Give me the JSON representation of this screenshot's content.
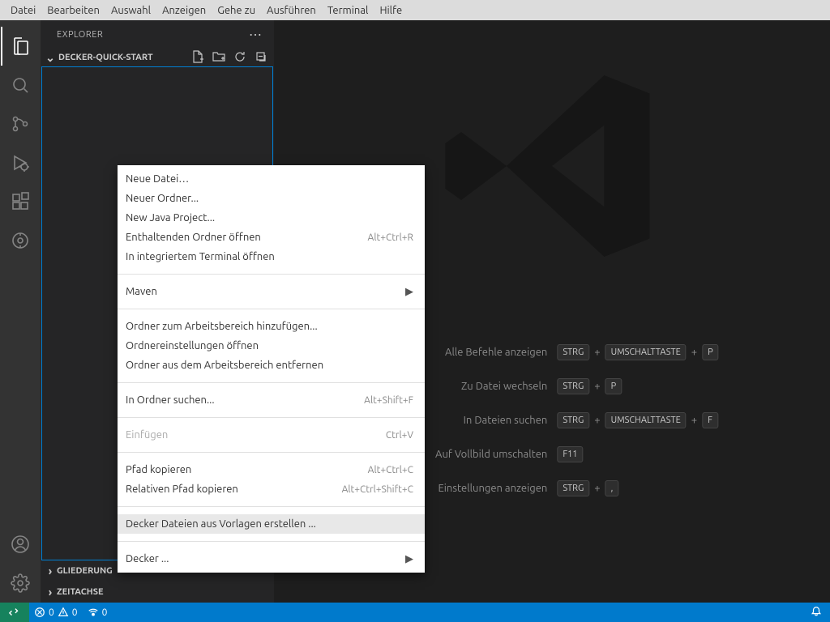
{
  "menubar": [
    "Datei",
    "Bearbeiten",
    "Auswahl",
    "Anzeigen",
    "Gehe zu",
    "Ausführen",
    "Terminal",
    "Hilfe"
  ],
  "sidebar": {
    "title": "EXPLORER",
    "folder_name": "DECKER-QUICK-START",
    "outline": "GLIEDERUNG",
    "timeline": "ZEITACHSE"
  },
  "context_menu": {
    "group1": [
      {
        "label": "Neue Datei…",
        "shortcut": ""
      },
      {
        "label": "Neuer Ordner...",
        "shortcut": ""
      },
      {
        "label": "New Java Project...",
        "shortcut": ""
      },
      {
        "label": "Enthaltenden Ordner öffnen",
        "shortcut": "Alt+Ctrl+R"
      },
      {
        "label": "In integriertem Terminal öffnen",
        "shortcut": ""
      }
    ],
    "group2": [
      {
        "label": "Maven",
        "submenu": true
      }
    ],
    "group3": [
      {
        "label": "Ordner zum Arbeitsbereich hinzufügen...",
        "shortcut": ""
      },
      {
        "label": "Ordnereinstellungen öffnen",
        "shortcut": ""
      },
      {
        "label": "Ordner aus dem Arbeitsbereich entfernen",
        "shortcut": ""
      }
    ],
    "group4": [
      {
        "label": "In Ordner suchen...",
        "shortcut": "Alt+Shift+F"
      }
    ],
    "group5": [
      {
        "label": "Einfügen",
        "shortcut": "Ctrl+V",
        "disabled": true
      }
    ],
    "group6": [
      {
        "label": "Pfad kopieren",
        "shortcut": "Alt+Ctrl+C"
      },
      {
        "label": "Relativen Pfad kopieren",
        "shortcut": "Alt+Ctrl+Shift+C"
      }
    ],
    "group7": [
      {
        "label": "Decker Dateien aus Vorlagen erstellen ...",
        "highlighted": true
      }
    ],
    "group8": [
      {
        "label": "Decker ...",
        "submenu": true
      }
    ]
  },
  "shortcuts": [
    {
      "label": "Alle Befehle anzeigen",
      "keys": [
        "STRG",
        "UMSCHALTTASTE",
        "P"
      ]
    },
    {
      "label": "Zu Datei wechseln",
      "keys": [
        "STRG",
        "P"
      ]
    },
    {
      "label": "In Dateien suchen",
      "keys": [
        "STRG",
        "UMSCHALTTASTE",
        "F"
      ]
    },
    {
      "label": "Auf Vollbild umschalten",
      "keys": [
        "F11"
      ]
    },
    {
      "label": "Einstellungen anzeigen",
      "keys": [
        "STRG",
        ","
      ]
    }
  ],
  "statusbar": {
    "errors": "0",
    "warnings": "0",
    "ports": "0"
  }
}
